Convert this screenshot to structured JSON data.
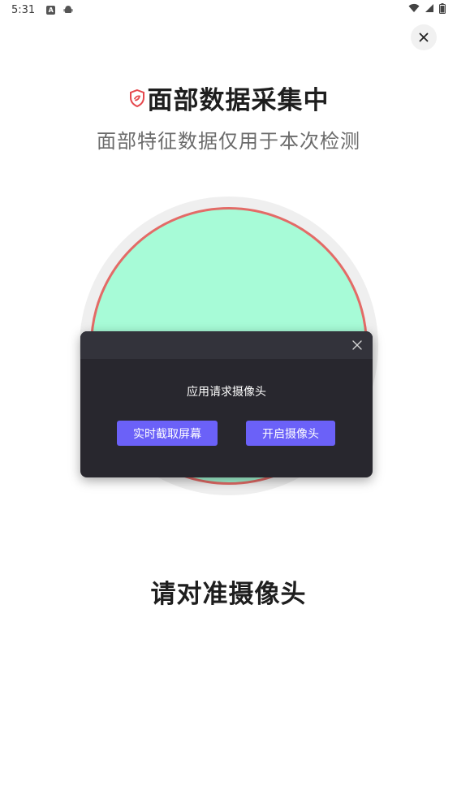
{
  "status_bar": {
    "time": "5:31",
    "left_icons": [
      "a-icon",
      "android-icon"
    ],
    "right_icons": [
      "wifi-icon",
      "signal-icon",
      "battery-icon"
    ]
  },
  "header": {
    "title": "面部数据采集中",
    "subtitle": "面部特征数据仅用于本次检测",
    "shield_color": "#e5484d"
  },
  "face_frame": {
    "fill_color": "#a7fbd7",
    "ring_color": "#e36b67"
  },
  "dialog": {
    "message": "应用请求摄像头",
    "buttons": {
      "screen_capture": "实时截取屏幕",
      "open_camera": "开启摄像头"
    },
    "button_color": "#6b61f8"
  },
  "instruction": "请对准摄像头"
}
